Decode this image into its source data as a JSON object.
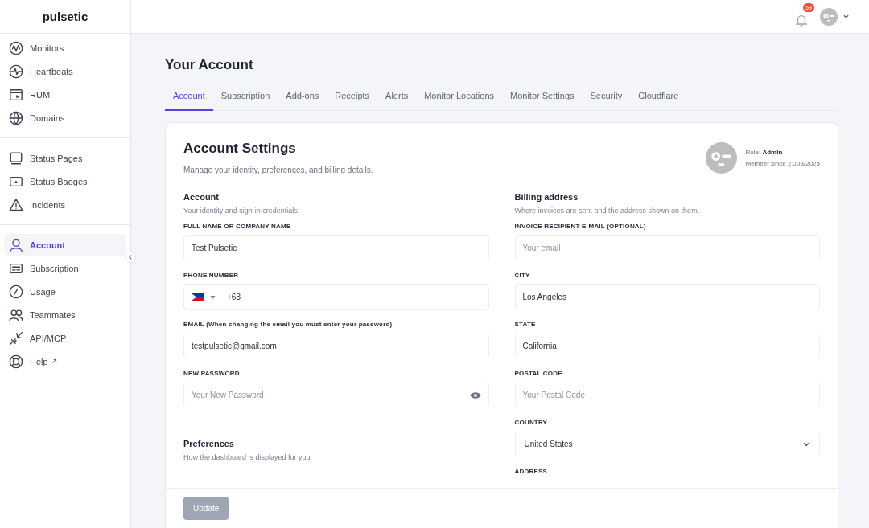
{
  "brand": "pulsetic",
  "sidebar": {
    "groups": [
      {
        "items": [
          {
            "label": "Monitors",
            "selected": false
          },
          {
            "label": "Heartbeats",
            "selected": false
          },
          {
            "label": "RUM",
            "selected": false
          },
          {
            "label": "Domains",
            "selected": false
          }
        ]
      },
      {
        "items": [
          {
            "label": "Status Pages",
            "selected": false
          },
          {
            "label": "Status Badges",
            "selected": false
          },
          {
            "label": "Incidents",
            "selected": false
          }
        ]
      },
      {
        "items": [
          {
            "label": "Account",
            "selected": true
          },
          {
            "label": "Subscription",
            "selected": false
          },
          {
            "label": "Usage",
            "selected": false
          },
          {
            "label": "Teammates",
            "selected": false
          },
          {
            "label": "API/MCP",
            "selected": false
          },
          {
            "label": "Help",
            "selected": false,
            "external": true
          }
        ]
      }
    ]
  },
  "topbar": {
    "notification_count": "59"
  },
  "page_title": "Your Account",
  "tabs": [
    {
      "label": "Account",
      "selected": true
    },
    {
      "label": "Subscription",
      "selected": false
    },
    {
      "label": "Add-ons",
      "selected": false
    },
    {
      "label": "Receipts",
      "selected": false
    },
    {
      "label": "Alerts",
      "selected": false
    },
    {
      "label": "Monitor Locations",
      "selected": false
    },
    {
      "label": "Monitor Settings",
      "selected": false
    },
    {
      "label": "Security",
      "selected": false
    },
    {
      "label": "Cloudflare",
      "selected": false
    }
  ],
  "card": {
    "title": "Account Settings",
    "subtitle": "Manage your identity, preferences, and billing details.",
    "role_label": "Role:",
    "role": "Admin",
    "member_since": "Member since 21/03/2025"
  },
  "columns": [
    {
      "title": "Account",
      "description": "Your identity and sign-in credentials.",
      "fields": [
        {
          "kind": "text",
          "label": "FULL NAME OR COMPANY NAME",
          "value": "Test Pulsetic"
        },
        {
          "kind": "phone",
          "label": "PHONE NUMBER",
          "value": "+63"
        },
        {
          "kind": "text",
          "label": "EMAIL (When changing the email you must enter your password)",
          "value": "testpulsetic@gmail.com"
        },
        {
          "kind": "password",
          "label": "NEW PASSWORD",
          "placeholder": "Your New Password"
        }
      ],
      "after": {
        "title": "Preferences",
        "description": "How the dashboard is displayed for you."
      }
    },
    {
      "title": "Billing address",
      "description": "Where invoices are sent and the address shown on them.",
      "fields": [
        {
          "kind": "text",
          "label": "INVOICE RECIPIENT E-MAIL (OPTIONAL)",
          "placeholder": "Your email"
        },
        {
          "kind": "text",
          "label": "CITY",
          "value": "Los Angeles"
        },
        {
          "kind": "text",
          "label": "STATE",
          "value": "California"
        },
        {
          "kind": "text",
          "label": "POSTAL CODE",
          "placeholder": "Your Postal Code"
        },
        {
          "kind": "select",
          "label": "COUNTRY",
          "value": "United States"
        },
        {
          "kind": "label",
          "label": "ADDRESS"
        }
      ]
    }
  ],
  "update_button": {
    "label": "Update",
    "disabled": true
  }
}
